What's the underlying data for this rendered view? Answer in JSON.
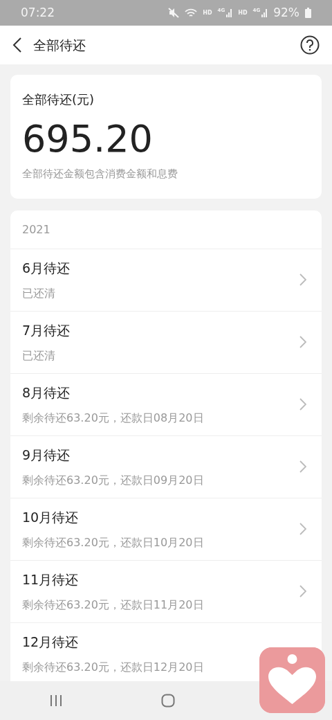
{
  "status_bar": {
    "time": "07:22",
    "signals": [
      {
        "label": "HD",
        "tech": "4G"
      },
      {
        "label": "HD",
        "tech": "4G"
      }
    ],
    "battery": "92%"
  },
  "header": {
    "title": "全部待还"
  },
  "summary": {
    "label": "全部待还(元)",
    "amount": "695.20",
    "note": "全部待还金额包含消费金额和息费"
  },
  "bills": {
    "year": "2021",
    "rows": [
      {
        "title": "6月待还",
        "detail": "已还清"
      },
      {
        "title": "7月待还",
        "detail": "已还清"
      },
      {
        "title": "8月待还",
        "detail": "剩余待还63.20元，还款日08月20日"
      },
      {
        "title": "9月待还",
        "detail": "剩余待还63.20元，还款日09月20日"
      },
      {
        "title": "10月待还",
        "detail": "剩余待还63.20元，还款日10月20日"
      },
      {
        "title": "11月待还",
        "detail": "剩余待还63.20元，还款日11月20日"
      },
      {
        "title": "12月待还",
        "detail": "剩余待还63.20元，还款日12月20日"
      }
    ]
  }
}
